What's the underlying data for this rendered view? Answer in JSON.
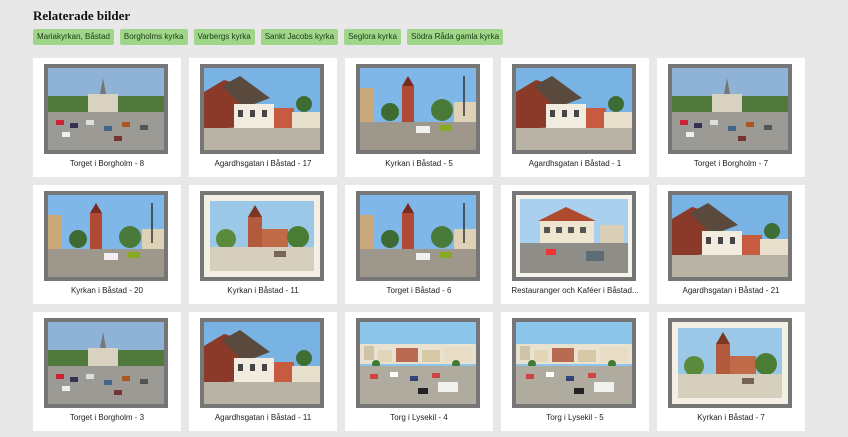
{
  "heading": "Relaterade bilder",
  "tags": [
    "Mariakyrkan, Båstad",
    "Borgholms kyrka",
    "Varbergs kyrka",
    "Sankt Jacobs kyrka",
    "Seglora kyrka",
    "Södra Råda gamla kyrka"
  ],
  "images": [
    {
      "caption": "Torget i Borgholm - 8",
      "scene": "square"
    },
    {
      "caption": "Agardhsgatan i Båstad - 17",
      "scene": "houses"
    },
    {
      "caption": "Kyrkan i Båstad - 5",
      "scene": "street"
    },
    {
      "caption": "Agardhsgatan i Båstad - 1",
      "scene": "houses"
    },
    {
      "caption": "Torget i Borgholm - 7",
      "scene": "square"
    },
    {
      "caption": "Kyrkan i Båstad - 20",
      "scene": "street"
    },
    {
      "caption": "Kyrkan i Båstad - 11",
      "scene": "church"
    },
    {
      "caption": "Torget i Båstad - 6",
      "scene": "street"
    },
    {
      "caption": "Restauranger och Kaféer i Båstad...",
      "scene": "restaurant"
    },
    {
      "caption": "Agardhsgatan i Båstad - 21",
      "scene": "houses"
    },
    {
      "caption": "Torget i Borgholm - 3",
      "scene": "square"
    },
    {
      "caption": "Agardhsgatan i Båstad - 11",
      "scene": "houses"
    },
    {
      "caption": "Torg i Lysekil - 4",
      "scene": "harbor"
    },
    {
      "caption": "Torg i Lysekil - 5",
      "scene": "harbor"
    },
    {
      "caption": "Kyrkan i Båstad - 7",
      "scene": "church"
    }
  ]
}
